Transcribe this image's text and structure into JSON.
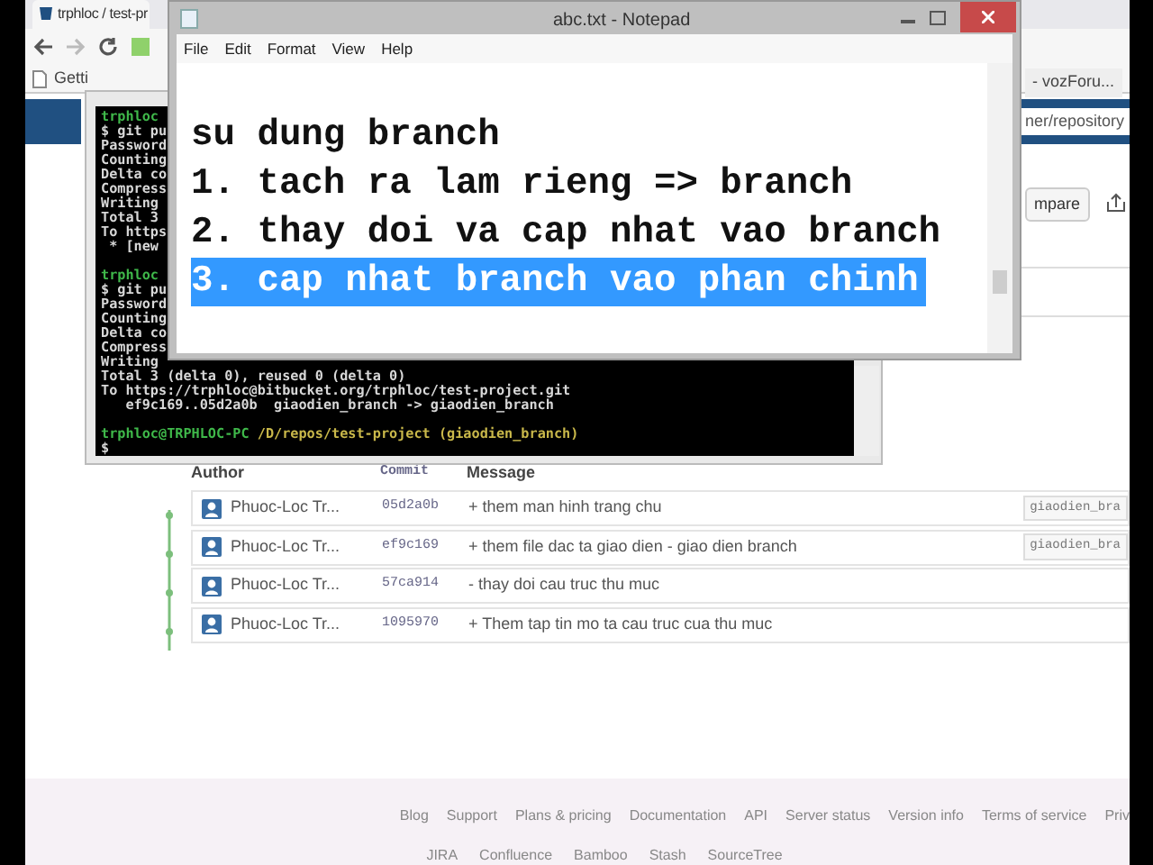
{
  "browser": {
    "tabs": [
      {
        "label": "trphloc / test-pr",
        "selected": true
      },
      {
        "label": "- vozForu...",
        "selected": false
      }
    ],
    "bookmark": "Getti",
    "address": "ner/repository",
    "compare_button": "mpare"
  },
  "terminal": {
    "lines": [
      {
        "kind": "prompt",
        "user": "trphloc"
      },
      {
        "kind": "output",
        "text": "$ git pu"
      },
      {
        "kind": "output",
        "text": "Password"
      },
      {
        "kind": "output",
        "text": "Counting"
      },
      {
        "kind": "output",
        "text": "Delta co"
      },
      {
        "kind": "output",
        "text": "Compress"
      },
      {
        "kind": "output",
        "text": "Writing"
      },
      {
        "kind": "output",
        "text": "Total 3"
      },
      {
        "kind": "output",
        "text": "To https"
      },
      {
        "kind": "output",
        "text": " * [new"
      },
      {
        "kind": "blank"
      },
      {
        "kind": "prompt",
        "user": "trphloc"
      },
      {
        "kind": "output",
        "text": "$ git pu"
      },
      {
        "kind": "output",
        "text": "Password"
      },
      {
        "kind": "output",
        "text": "Counting"
      },
      {
        "kind": "output",
        "text": "Delta co"
      },
      {
        "kind": "output",
        "text": "Compress"
      },
      {
        "kind": "output",
        "text": "Writing"
      },
      {
        "kind": "output",
        "text": "Total 3 (delta 0), reused 0 (delta 0)"
      },
      {
        "kind": "output",
        "text": "To https://trphloc@bitbucket.org/trphloc/test-project.git"
      },
      {
        "kind": "output",
        "text": "   ef9c169..05d2a0b  giaodien_branch -> giaodien_branch"
      },
      {
        "kind": "blank"
      },
      {
        "kind": "prompt",
        "user": "trphloc@TRPHLOC-PC",
        "path": "/D/repos/test-project",
        "branch": "(giaodien_branch)"
      },
      {
        "kind": "output",
        "text": "$"
      }
    ]
  },
  "commits": {
    "columns": [
      "Author",
      "Commit",
      "Message"
    ],
    "rows": [
      {
        "author": "Phuoc-Loc Tr...",
        "commit": "05d2a0b",
        "message": "+ them man hinh trang chu",
        "branch": "giaodien_bra"
      },
      {
        "author": "Phuoc-Loc Tr...",
        "commit": "ef9c169",
        "message": "+ them file dac ta giao dien - giao dien branch",
        "branch": "giaodien_bra"
      },
      {
        "author": "Phuoc-Loc Tr...",
        "commit": "57ca914",
        "message": "- thay doi cau truc thu muc"
      },
      {
        "author": "Phuoc-Loc Tr...",
        "commit": "1095970",
        "message": "+ Them tap tin mo ta cau truc cua thu muc"
      }
    ]
  },
  "footer": {
    "links": [
      "Blog",
      "Support",
      "Plans & pricing",
      "Documentation",
      "API",
      "Server status",
      "Version info",
      "Terms of service",
      "Priv"
    ],
    "products": [
      "JIRA",
      "Confluence",
      "Bamboo",
      "Stash",
      "SourceTree"
    ]
  },
  "notepad": {
    "title": "abc.txt - Notepad",
    "menu": [
      "File",
      "Edit",
      "Format",
      "View",
      "Help"
    ],
    "lines": [
      {
        "text": "su dung branch",
        "selected": false
      },
      {
        "text": "1. tach ra lam rieng => branch",
        "selected": false
      },
      {
        "text": "2. thay doi va cap nhat vao branch",
        "selected": false
      },
      {
        "text": "3. cap nhat branch vao phan chinh",
        "selected": true
      }
    ]
  }
}
